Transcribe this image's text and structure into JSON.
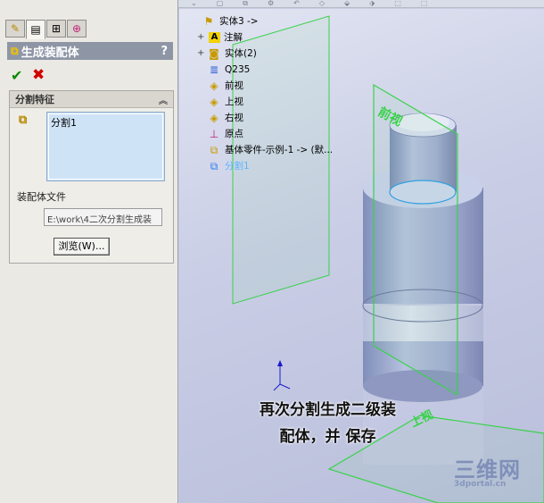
{
  "toolbar": {
    "items": [
      "⌄",
      "▢",
      "⧉",
      "⚙",
      "↶",
      "◇",
      "⬙",
      "⬗",
      "⬚",
      "⬚"
    ]
  },
  "property_manager": {
    "tabs": [
      {
        "icon": "feature-manager-icon",
        "glyph": "✎"
      },
      {
        "icon": "property-manager-icon",
        "glyph": "▤"
      },
      {
        "icon": "configuration-manager-icon",
        "glyph": "⊞"
      },
      {
        "icon": "dimxpert-icon",
        "glyph": "⊕"
      }
    ],
    "title": "生成装配体",
    "help": "?",
    "ok": "✔",
    "cancel": "✖",
    "group": {
      "title": "分割特征",
      "selection": "分割1",
      "assembly_file_label": "装配体文件",
      "assembly_file_value": "E:\\work\\4二次分割生成装",
      "browse": "浏览(W)..."
    }
  },
  "tree": [
    {
      "expander": "",
      "icon": "part-icon",
      "glyph": "⚑",
      "label": "实体3 ->"
    },
    {
      "expander": "+",
      "icon": "annotation-icon",
      "glyph": "A",
      "label": "注解"
    },
    {
      "expander": "+",
      "icon": "solid-bodies-icon",
      "glyph": "◙",
      "label": "实体(2)"
    },
    {
      "expander": "",
      "icon": "material-icon",
      "glyph": "≣",
      "label": "Q235"
    },
    {
      "expander": "",
      "icon": "plane-icon",
      "glyph": "◈",
      "label": "前视"
    },
    {
      "expander": "",
      "icon": "plane-icon",
      "glyph": "◈",
      "label": "上视"
    },
    {
      "expander": "",
      "icon": "plane-icon",
      "glyph": "◈",
      "label": "右视"
    },
    {
      "expander": "",
      "icon": "origin-icon",
      "glyph": "⊥",
      "label": "原点"
    },
    {
      "expander": "",
      "icon": "base-part-icon",
      "glyph": "⧉",
      "label": "基体零件-示例-1 -> (默..."
    },
    {
      "expander": "",
      "icon": "split-feature-icon",
      "glyph": "⧉",
      "label": "分割1"
    }
  ],
  "planes": {
    "front": "前视",
    "top": "上视"
  },
  "caption": {
    "line1": "再次分割生成二级装",
    "line2": "配体，并 保存"
  },
  "watermark": {
    "brand": "三维网",
    "url": "3dportal.cn"
  },
  "colors": {
    "plane_green": "#39d24a",
    "selection_blue": "#cfe3f7",
    "header_gray": "#8e96a6"
  }
}
